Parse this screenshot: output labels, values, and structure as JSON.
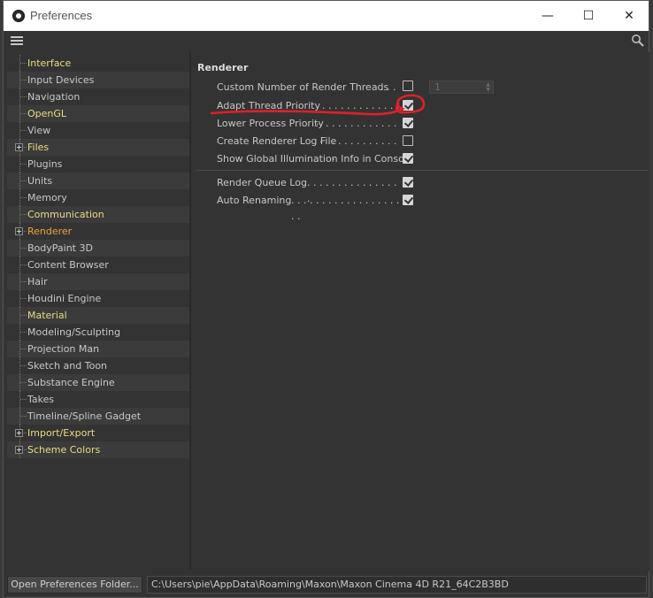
{
  "window": {
    "title": "Preferences",
    "controls": {
      "minimize": "—",
      "maximize": "☐",
      "close": "✕"
    }
  },
  "menu": {
    "menu_icon": "hamburger-icon",
    "search_icon": "search-icon"
  },
  "sidebar": {
    "items": [
      {
        "label": "Interface",
        "style": "hl",
        "expandable": false
      },
      {
        "label": "Input Devices",
        "style": "normal",
        "expandable": false
      },
      {
        "label": "Navigation",
        "style": "normal",
        "expandable": false
      },
      {
        "label": "OpenGL",
        "style": "hl",
        "expandable": false
      },
      {
        "label": "View",
        "style": "normal",
        "expandable": false
      },
      {
        "label": "Files",
        "style": "hl",
        "expandable": true
      },
      {
        "label": "Plugins",
        "style": "normal",
        "expandable": false
      },
      {
        "label": "Units",
        "style": "normal",
        "expandable": false
      },
      {
        "label": "Memory",
        "style": "normal",
        "expandable": false
      },
      {
        "label": "Communication",
        "style": "hl",
        "expandable": false
      },
      {
        "label": "Renderer",
        "style": "sel",
        "expandable": true
      },
      {
        "label": "BodyPaint 3D",
        "style": "normal",
        "expandable": false
      },
      {
        "label": "Content Browser",
        "style": "normal",
        "expandable": false
      },
      {
        "label": "Hair",
        "style": "normal",
        "expandable": false
      },
      {
        "label": "Houdini Engine",
        "style": "normal",
        "expandable": false
      },
      {
        "label": "Material",
        "style": "hl",
        "expandable": false
      },
      {
        "label": "Modeling/Sculpting",
        "style": "normal",
        "expandable": false
      },
      {
        "label": "Projection Man",
        "style": "normal",
        "expandable": false
      },
      {
        "label": "Sketch and Toon",
        "style": "normal",
        "expandable": false
      },
      {
        "label": "Substance Engine",
        "style": "normal",
        "expandable": false
      },
      {
        "label": "Takes",
        "style": "normal",
        "expandable": false
      },
      {
        "label": "Timeline/Spline Gadget",
        "style": "normal",
        "expandable": false
      },
      {
        "label": "Import/Export",
        "style": "hl",
        "expandable": true
      },
      {
        "label": "Scheme Colors",
        "style": "hl",
        "expandable": true
      }
    ]
  },
  "main": {
    "section_title": "Renderer",
    "options": [
      {
        "label": "Custom Number of Render Threads",
        "checked": false
      },
      {
        "label": "Adapt Thread Priority",
        "checked": true
      },
      {
        "label": "Lower Process Priority",
        "checked": true
      },
      {
        "label": "Create Renderer Log File",
        "checked": false
      },
      {
        "label": "Show Global Illumination Info in Console",
        "checked": true
      }
    ],
    "thread_count": "1",
    "options2": [
      {
        "label": "Render Queue Log",
        "checked": true
      },
      {
        "label": "Auto Renaming",
        "checked": true
      }
    ],
    "annotation_color": "#e0202a"
  },
  "footer": {
    "button_label": "Open Preferences Folder...",
    "path": "C:\\Users\\pie\\AppData\\Roaming\\Maxon\\Maxon Cinema 4D R21_64C2B3BD"
  }
}
